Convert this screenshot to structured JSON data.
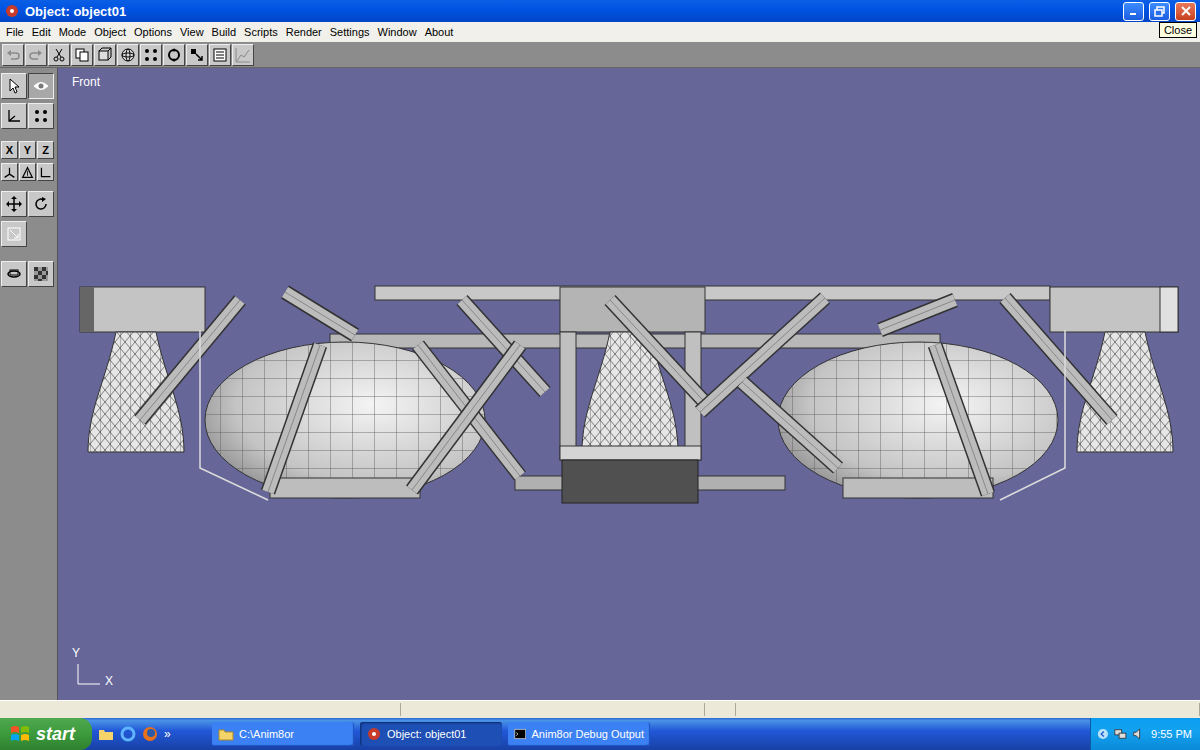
{
  "window": {
    "title": "Object: object01"
  },
  "tooltip": {
    "text": "Close"
  },
  "menu": [
    "File",
    "Edit",
    "Mode",
    "Object",
    "Options",
    "View",
    "Build",
    "Scripts",
    "Render",
    "Settings",
    "Window",
    "About"
  ],
  "toolbar": [
    {
      "kind": "undo",
      "disabled": true
    },
    {
      "kind": "redo",
      "disabled": true
    },
    {
      "kind": "cut",
      "disabled": false
    },
    {
      "kind": "copy",
      "disabled": false
    },
    {
      "kind": "frame",
      "disabled": false
    },
    {
      "kind": "sphere",
      "disabled": false
    },
    {
      "kind": "points",
      "disabled": false
    },
    {
      "kind": "ring",
      "disabled": false
    },
    {
      "kind": "join",
      "disabled": false
    },
    {
      "kind": "list",
      "disabled": false
    },
    {
      "kind": "graph",
      "disabled": true
    }
  ],
  "left_tools": {
    "top": [
      {
        "kind": "arrow",
        "selected": false
      },
      {
        "kind": "eye",
        "selected": true
      },
      {
        "kind": "axis",
        "selected": false
      },
      {
        "kind": "points",
        "selected": false
      }
    ],
    "axes": [
      {
        "label": "X",
        "selected": false
      },
      {
        "label": "Y",
        "selected": false
      },
      {
        "label": "Z",
        "selected": false
      }
    ],
    "modes": [
      {
        "kind": "world",
        "selected": false
      },
      {
        "kind": "object",
        "selected": false
      },
      {
        "kind": "screen",
        "selected": false
      }
    ],
    "transform": [
      {
        "kind": "move",
        "selected": false
      },
      {
        "kind": "rotate",
        "selected": false
      },
      {
        "kind": "scale",
        "selected": false
      }
    ],
    "extra": [
      {
        "kind": "layer",
        "selected": false
      },
      {
        "kind": "checker",
        "selected": false
      }
    ]
  },
  "viewport": {
    "label": "Front",
    "axes": {
      "vertical": "Y",
      "horizontal": "X"
    }
  },
  "taskbar": {
    "start": "start",
    "quick_launch_more": "»",
    "tasks": [
      {
        "label": "C:\\Anim8or",
        "kind": "folder",
        "selected": false
      },
      {
        "label": "Object: object01",
        "kind": "app",
        "selected": true
      },
      {
        "label": "Anim8or Debug Output",
        "kind": "console",
        "selected": false
      }
    ],
    "clock": "9:55 PM"
  }
}
